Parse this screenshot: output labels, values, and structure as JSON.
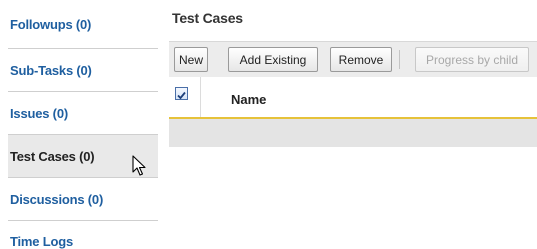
{
  "sidebar": {
    "items": [
      {
        "label": "Followups (0)",
        "active": false
      },
      {
        "label": "Sub-Tasks (0)",
        "active": false
      },
      {
        "label": "Issues (0)",
        "active": false
      },
      {
        "label": "Test Cases (0)",
        "active": true
      },
      {
        "label": "Discussions (0)",
        "active": false
      },
      {
        "label": "Time Logs",
        "active": false
      }
    ]
  },
  "main": {
    "title": "Test Cases",
    "toolbar": {
      "new_label": "New",
      "add_existing_label": "Add Existing",
      "remove_label": "Remove",
      "progress_by_child_label": "Progress by child"
    },
    "grid": {
      "select_all_checked": true,
      "columns": [
        "Name"
      ]
    }
  },
  "colors": {
    "link": "#1f5fa0",
    "header_underline": "#e6c23a",
    "toolbar_bg": "#ececec"
  }
}
